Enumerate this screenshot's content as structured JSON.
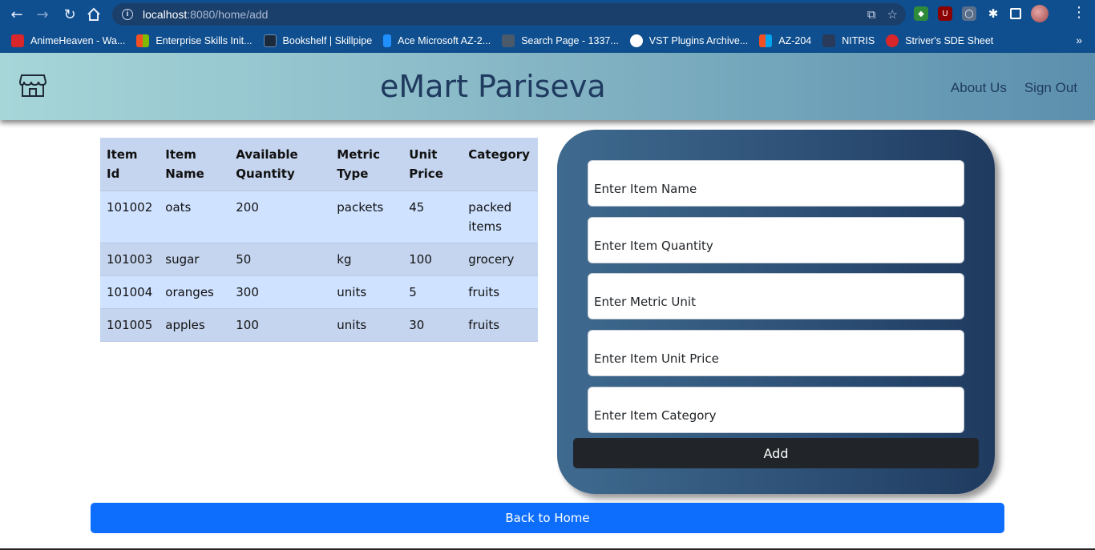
{
  "browser": {
    "url_host": "localhost",
    "url_rest": ":8080/home/add",
    "bookmarks": [
      {
        "label": "AnimeHeaven - Wa...",
        "color": "#d9262b"
      },
      {
        "label": "Enterprise Skills Init...",
        "color": "#f25022"
      },
      {
        "label": "Bookshelf | Skillpipe",
        "color": "#1b2a3b"
      },
      {
        "label": "Ace Microsoft AZ-2...",
        "color": "#1e90ff"
      },
      {
        "label": "Search Page - 1337...",
        "color": "#4a5a6a"
      },
      {
        "label": "VST Plugins Archive...",
        "color": "#ffffff"
      },
      {
        "label": "AZ-204",
        "color": "#f25022"
      },
      {
        "label": "NITRIS",
        "color": "#2a3a5a"
      },
      {
        "label": "Striver's SDE Sheet",
        "color": "#d9262b"
      }
    ]
  },
  "header": {
    "brand": "eMart Pariseva",
    "nav": {
      "about": "About Us",
      "signout": "Sign Out"
    }
  },
  "table": {
    "headers": [
      "Item Id",
      "Item Name",
      "Available Quantity",
      "Metric Type",
      "Unit Price",
      "Category"
    ],
    "rows": [
      [
        "101002",
        "oats",
        "200",
        "packets",
        "45",
        "packed items"
      ],
      [
        "101003",
        "sugar",
        "50",
        "kg",
        "100",
        "grocery"
      ],
      [
        "101004",
        "oranges",
        "300",
        "units",
        "5",
        "fruits"
      ],
      [
        "101005",
        "apples",
        "100",
        "units",
        "30",
        "fruits"
      ]
    ]
  },
  "form": {
    "item_name_placeholder": "Enter Item Name",
    "item_quantity_placeholder": "Enter Item Quantity",
    "metric_unit_placeholder": "Enter Metric Unit",
    "unit_price_placeholder": "Enter Item Unit Price",
    "category_placeholder": "Enter Item Category",
    "add_label": "Add"
  },
  "footer": {
    "back_label": "Back to Home"
  }
}
